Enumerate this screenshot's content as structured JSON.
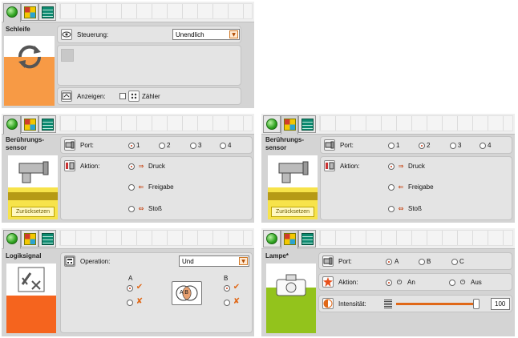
{
  "colors": {
    "loop": "#f79a45",
    "sensor": "#f7e34a",
    "logic": "#f5641e",
    "lamp": "#93c31c",
    "accent": "#e85a1c"
  },
  "icons": [
    "program-tab-icon",
    "palette-tab-icon",
    "data-tab-icon",
    "loop-arrows-icon",
    "touch-sensor-icon",
    "logic-icon",
    "lamp-icon"
  ],
  "schleife": {
    "title": "Schleife",
    "control_label": "Steuerung:",
    "control_value": "Unendlich",
    "show_label": "Anzeigen:",
    "counter_label": "Zähler",
    "counter_checked": false
  },
  "sensor1": {
    "title": "Berührungs-\nsensor",
    "port_label": "Port:",
    "ports": [
      "1",
      "2",
      "3",
      "4"
    ],
    "selected_port": "1",
    "action_label": "Aktion:",
    "actions": [
      "Druck",
      "Freigabe",
      "Stoß"
    ],
    "selected_action": "Druck",
    "reset_label": "Zurücksetzen"
  },
  "sensor2": {
    "title": "Berührungs-\nsensor",
    "port_label": "Port:",
    "ports": [
      "1",
      "2",
      "3",
      "4"
    ],
    "selected_port": "2",
    "action_label": "Aktion:",
    "actions": [
      "Druck",
      "Freigabe",
      "Stoß"
    ],
    "selected_action": "Druck",
    "reset_label": "Zurücksetzen"
  },
  "logic": {
    "title": "Logiksignal",
    "operation_label": "Operation:",
    "operation_value": "Und",
    "a_label": "A",
    "b_label": "B",
    "venn_label": "A B"
  },
  "lamp": {
    "title": "Lampe*",
    "port_label": "Port:",
    "ports": [
      "A",
      "B",
      "C"
    ],
    "selected_port": "A",
    "action_label": "Aktion:",
    "actions": [
      "An",
      "Aus"
    ],
    "selected_action": "An",
    "intensity_label": "Intensität:",
    "intensity_value": "100",
    "intensity_fraction": 1.0
  }
}
